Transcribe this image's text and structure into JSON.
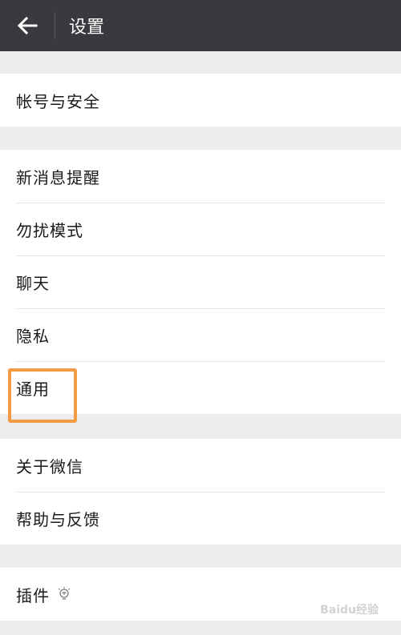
{
  "header": {
    "back_icon": "arrow-left-icon",
    "title": "设置"
  },
  "sections": [
    {
      "items": [
        {
          "label": "帐号与安全"
        }
      ]
    },
    {
      "items": [
        {
          "label": "新消息提醒"
        },
        {
          "label": "勿扰模式"
        },
        {
          "label": "聊天"
        },
        {
          "label": "隐私"
        },
        {
          "label": "通用"
        }
      ]
    },
    {
      "items": [
        {
          "label": "关于微信"
        },
        {
          "label": "帮助与反馈"
        }
      ]
    },
    {
      "items": [
        {
          "label": "插件",
          "icon": "bulb-icon"
        }
      ]
    }
  ],
  "highlight": {
    "target": "通用",
    "color": "#f39a45"
  },
  "watermark": {
    "text": "Baidu经验"
  },
  "colors": {
    "header_bg": "#393a3f",
    "page_bg": "#ececec",
    "row_bg": "#ffffff"
  }
}
